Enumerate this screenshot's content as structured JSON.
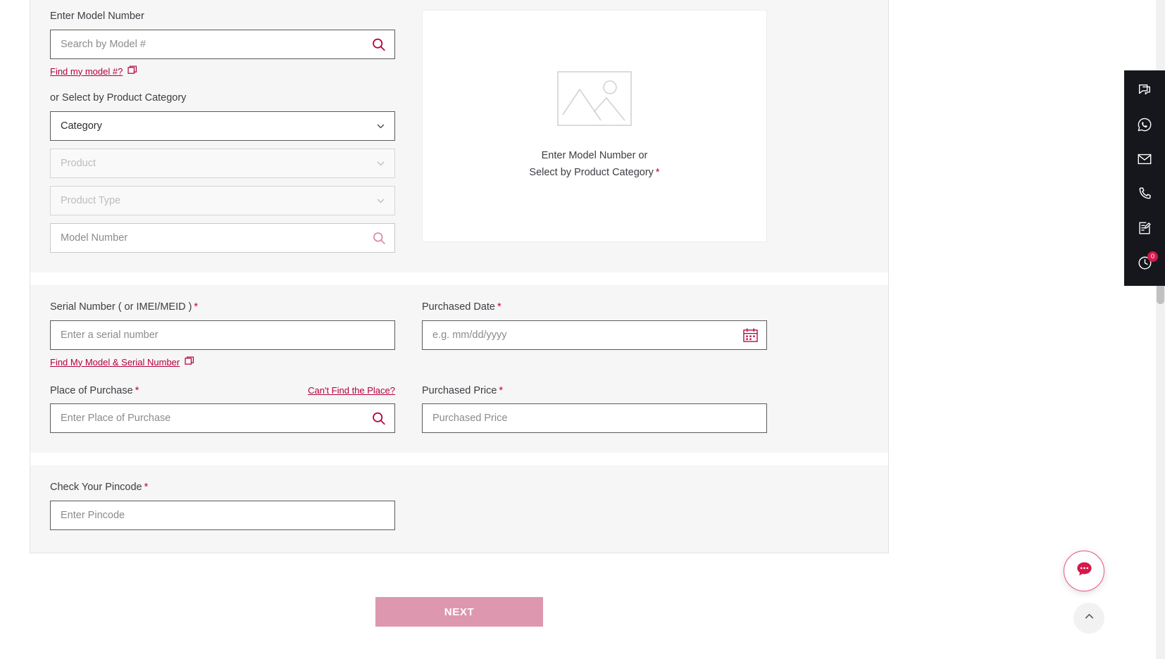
{
  "form": {
    "model_section": {
      "model_label": "Enter Model Number",
      "model_search_placeholder": "Search by Model #",
      "find_model_link": "Find my model #?",
      "category_label": "or Select by Product Category",
      "category_value": "Category",
      "product_placeholder": "Product",
      "product_type_placeholder": "Product Type",
      "model_number_placeholder": "Model Number"
    },
    "preview": {
      "line1": "Enter Model Number or",
      "line2": "Select by Product Category",
      "required_mark": "*"
    },
    "details_section": {
      "serial_label": "Serial Number ( or IMEI/MEID )",
      "serial_placeholder": "Enter a serial number",
      "serial_link": "Find My Model & Serial Number",
      "date_label": "Purchased Date",
      "date_placeholder": "e.g. mm/dd/yyyy",
      "place_label": "Place of Purchase",
      "place_placeholder": "Enter Place of Purchase",
      "place_help_link": "Can't Find the Place?",
      "price_label": "Purchased Price",
      "price_placeholder": "Purchased Price"
    },
    "pincode_section": {
      "pincode_label": "Check Your Pincode",
      "pincode_placeholder": "Enter Pincode"
    },
    "required_mark": "*",
    "next_label": "NEXT"
  },
  "rail": {
    "items": [
      {
        "name": "chat-bubbles-icon",
        "badge": null
      },
      {
        "name": "whatsapp-icon",
        "badge": null
      },
      {
        "name": "email-icon",
        "badge": null
      },
      {
        "name": "phone-icon",
        "badge": null
      },
      {
        "name": "form-edit-icon",
        "badge": null
      },
      {
        "name": "history-clock-icon",
        "badge": "0"
      }
    ],
    "history_badge": "0"
  },
  "colors": {
    "brand_crimson": "#b4003a",
    "accent_pink": "#d6194a",
    "next_button": "#dd97ae",
    "rail_background": "#16171c",
    "label_text": "#3d3d44",
    "placeholder_text": "#8b8b90",
    "input_border": "#5a5a5f",
    "card_background": "#f6f6f6"
  }
}
